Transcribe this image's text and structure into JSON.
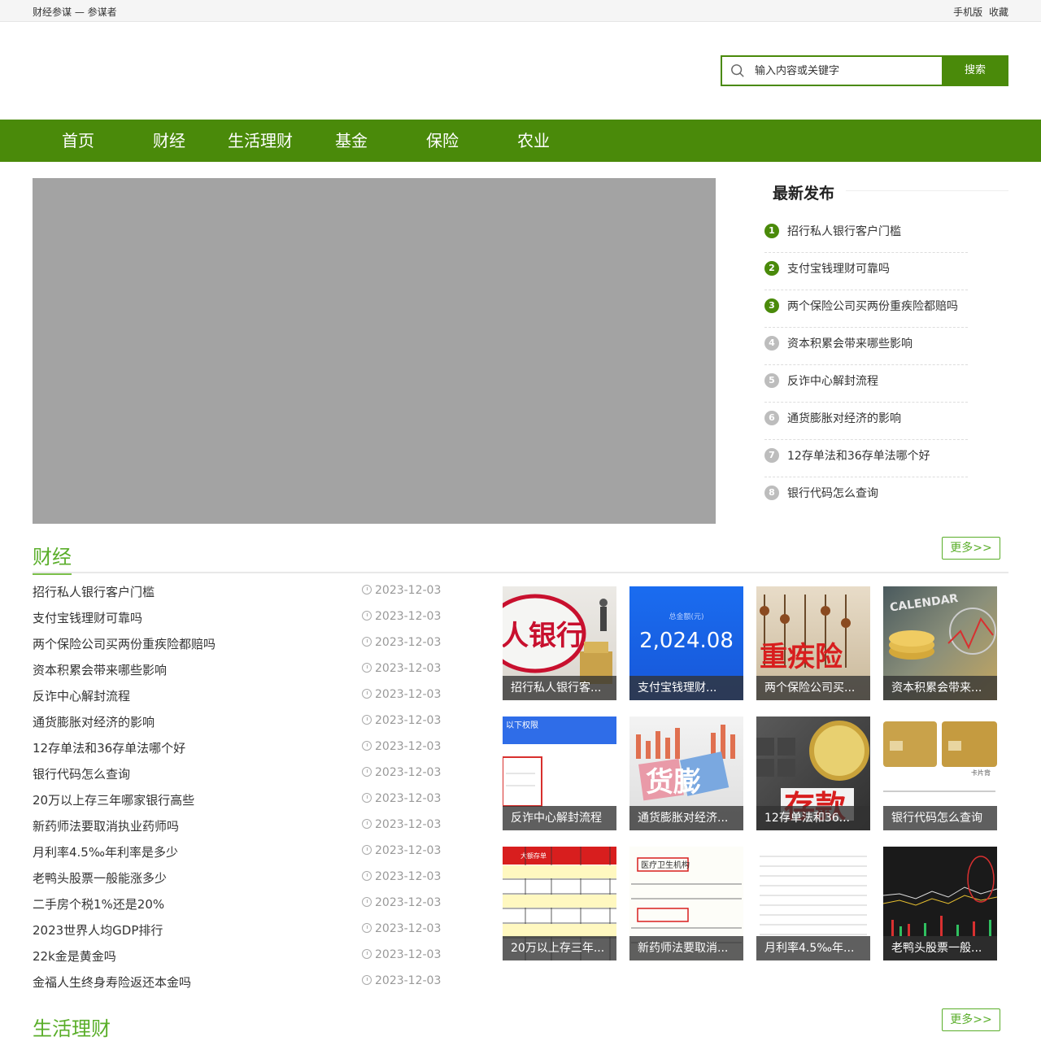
{
  "topbar": {
    "site_name": "财经参谋 — 参谋者",
    "mobile_label": "手机版",
    "favorite_label": "收藏"
  },
  "search": {
    "placeholder": "输入内容或关键字",
    "button_label": "搜索"
  },
  "nav": {
    "items": [
      "首页",
      "财经",
      "生活理财",
      "基金",
      "保险",
      "农业"
    ]
  },
  "latest": {
    "title": "最新发布",
    "items": [
      {
        "rank": "1",
        "title": "招行私人银行客户门槛"
      },
      {
        "rank": "2",
        "title": "支付宝钱理财可靠吗"
      },
      {
        "rank": "3",
        "title": "两个保险公司买两份重疾险都赔吗"
      },
      {
        "rank": "4",
        "title": "资本积累会带来哪些影响"
      },
      {
        "rank": "5",
        "title": "反诈中心解封流程"
      },
      {
        "rank": "6",
        "title": "通货膨胀对经济的影响"
      },
      {
        "rank": "7",
        "title": "12存单法和36存单法哪个好"
      },
      {
        "rank": "8",
        "title": "银行代码怎么查询"
      }
    ]
  },
  "sections": {
    "finance": {
      "title": "财经",
      "more": "更多>>"
    },
    "life": {
      "title": "生活理财",
      "more": "更多>>"
    }
  },
  "finance_list": [
    {
      "title": "招行私人银行客户门槛",
      "date": "2023-12-03"
    },
    {
      "title": "支付宝钱理财可靠吗",
      "date": "2023-12-03"
    },
    {
      "title": "两个保险公司买两份重疾险都赔吗",
      "date": "2023-12-03"
    },
    {
      "title": "资本积累会带来哪些影响",
      "date": "2023-12-03"
    },
    {
      "title": "反诈中心解封流程",
      "date": "2023-12-03"
    },
    {
      "title": "通货膨胀对经济的影响",
      "date": "2023-12-03"
    },
    {
      "title": "12存单法和36存单法哪个好",
      "date": "2023-12-03"
    },
    {
      "title": "银行代码怎么查询",
      "date": "2023-12-03"
    },
    {
      "title": "20万以上存三年哪家银行高些",
      "date": "2023-12-03"
    },
    {
      "title": "新药师法要取消执业药师吗",
      "date": "2023-12-03"
    },
    {
      "title": "月利率4.5‰年利率是多少",
      "date": "2023-12-03"
    },
    {
      "title": "老鸭头股票一般能涨多少",
      "date": "2023-12-03"
    },
    {
      "title": "二手房个税1%还是20%",
      "date": "2023-12-03"
    },
    {
      "title": "2023世界人均GDP排行",
      "date": "2023-12-03"
    },
    {
      "title": "22k金是黄金吗",
      "date": "2023-12-03"
    },
    {
      "title": "金福人生终身寿险返还本金吗",
      "date": "2023-12-03"
    }
  ],
  "thumbs": [
    {
      "caption": "招行私人银行客...",
      "image_text": "人银行"
    },
    {
      "caption": "支付宝钱理财...",
      "image_text": "2,024.08",
      "image_subtext": "总金额(元)"
    },
    {
      "caption": "两个保险公司买...",
      "image_text": "重疾险"
    },
    {
      "caption": "资本积累会带来...",
      "image_text": "CALENDAR"
    },
    {
      "caption": "反诈中心解封流程",
      "image_text": "以下权限"
    },
    {
      "caption": "通货膨胀对经济...",
      "image_text": "货膨"
    },
    {
      "caption": "12存单法和36...",
      "image_text": "存款"
    },
    {
      "caption": "银行代码怎么查询",
      "image_text": "卡片背"
    },
    {
      "caption": "20万以上存三年...",
      "image_text": "大额存单"
    },
    {
      "caption": "新药师法要取消...",
      "image_text": "医疗卫生机构"
    },
    {
      "caption": "月利率4.5‰年...",
      "image_text": ""
    },
    {
      "caption": "老鸭头股票一般...",
      "image_text": ""
    }
  ]
}
